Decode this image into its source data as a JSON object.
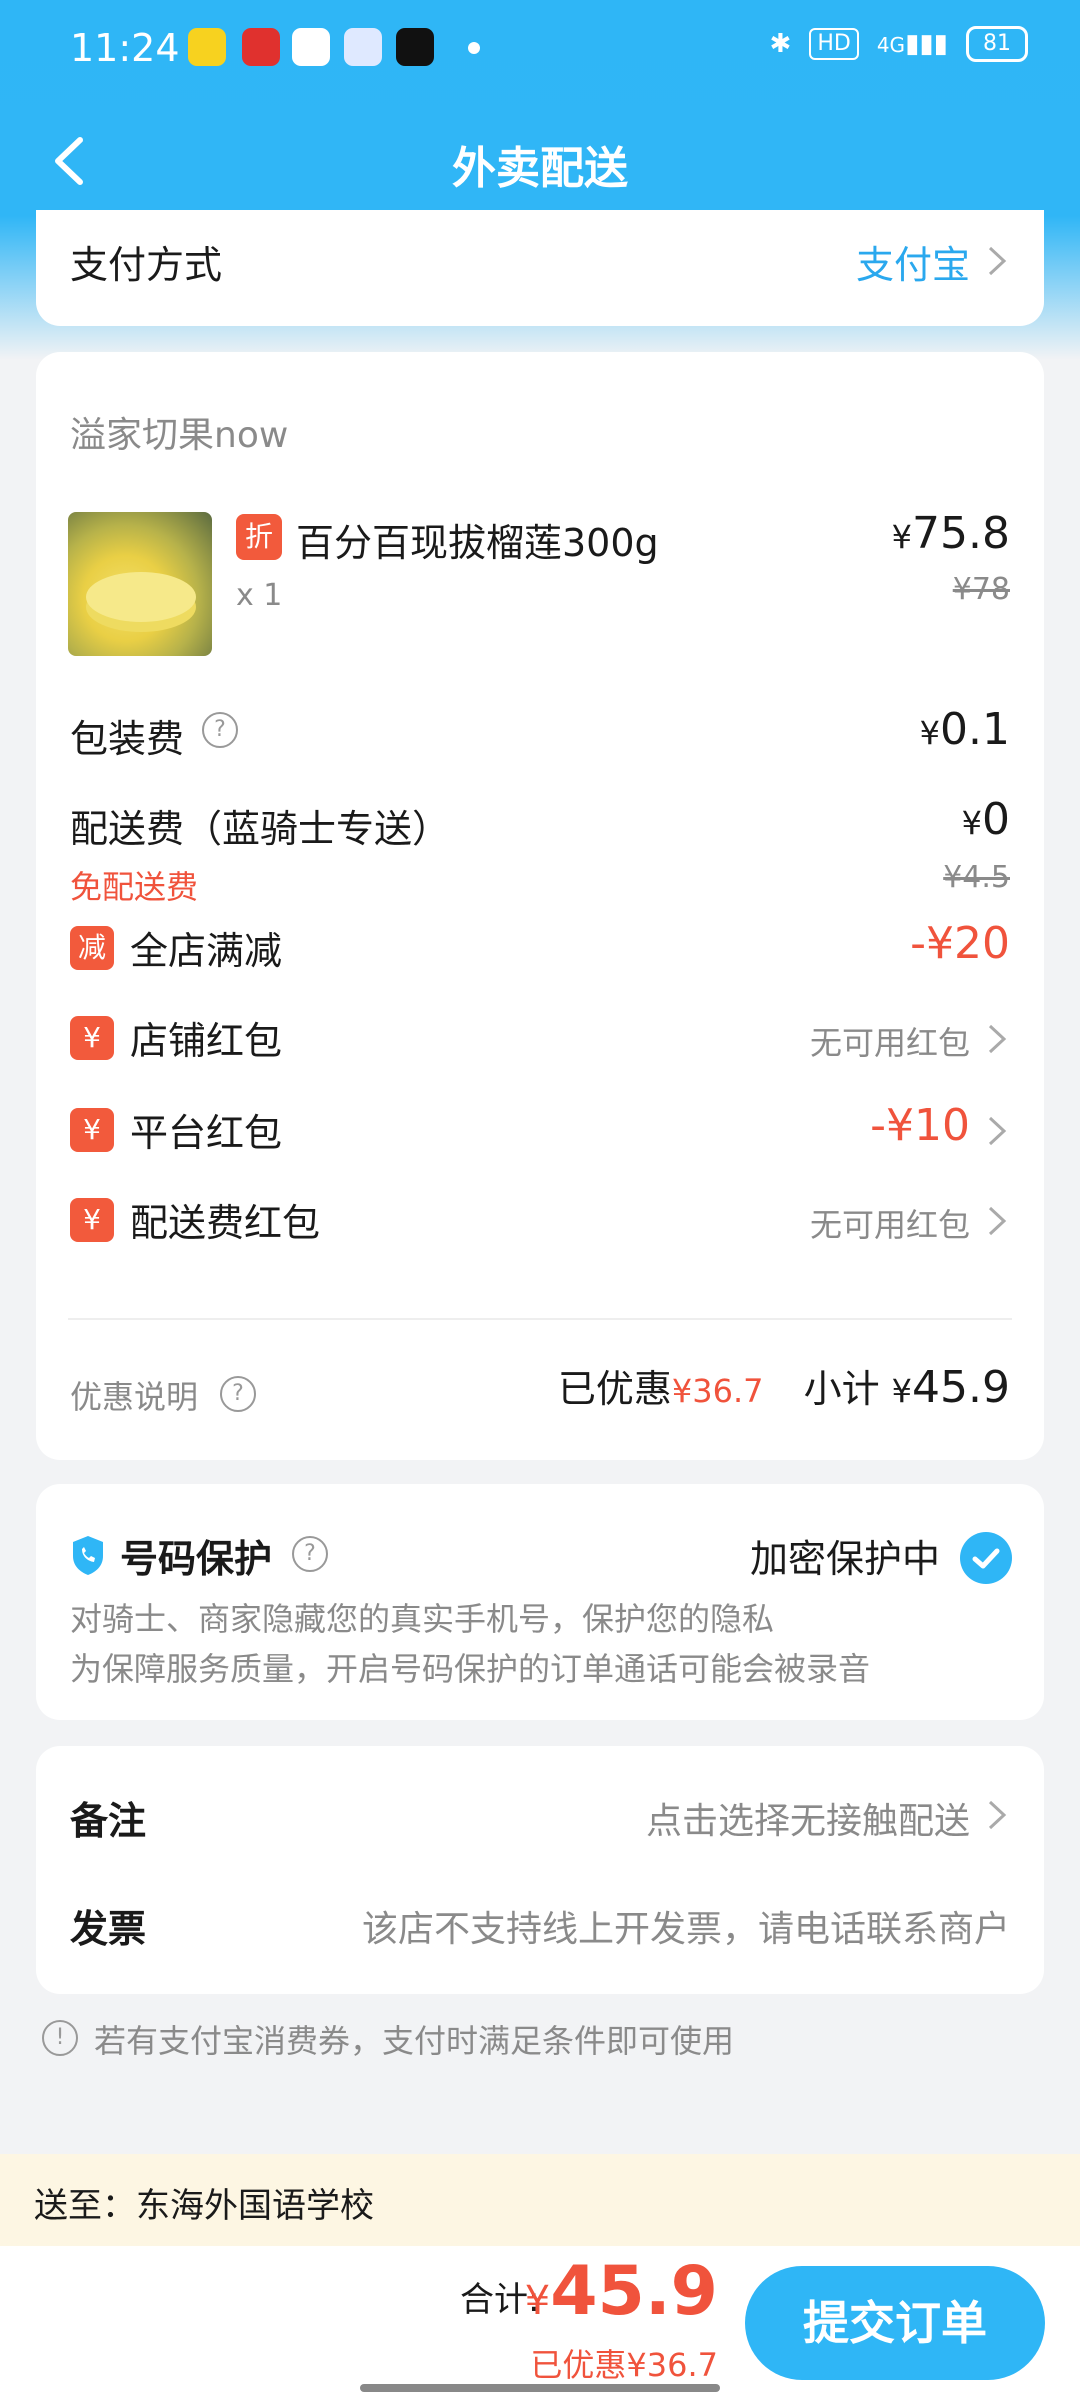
{
  "status_bar": {
    "time": "11:24",
    "hd": "HD",
    "network": "4G",
    "battery": "81"
  },
  "nav": {
    "title": "外卖配送"
  },
  "payment": {
    "label": "支付方式",
    "value": "支付宝"
  },
  "store": {
    "name": "溢家切果now",
    "product": {
      "discount_badge": "折",
      "name": "百分百现拔榴莲300g",
      "qty": "x 1",
      "price": "75.8",
      "original_price": "¥78"
    },
    "packaging": {
      "label": "包装费",
      "value": "0.1"
    },
    "delivery": {
      "label": "配送费（蓝骑士专送）",
      "free_note": "免配送费",
      "value": "0",
      "original": "¥4.5"
    },
    "store_discount": {
      "badge": "减",
      "label": "全店满减",
      "value": "-¥20"
    },
    "store_redpacket": {
      "badge": "¥",
      "label": "店铺红包",
      "value": "无可用红包"
    },
    "platform_redpacket": {
      "badge": "¥",
      "label": "平台红包",
      "value": "-¥10"
    },
    "delivery_redpacket": {
      "badge": "¥",
      "label": "配送费红包",
      "value": "无可用红包"
    },
    "summary": {
      "discount_info_label": "优惠说明",
      "saved_label": "已优惠",
      "saved_value": "¥36.7",
      "subtotal_label": "小计",
      "subtotal_value": "45.9"
    }
  },
  "privacy": {
    "title": "号码保护",
    "status": "加密保护中",
    "line1": "对骑士、商家隐藏您的真实手机号，保护您的隐私",
    "line2": "为保障服务质量，开启号码保护的订单通话可能会被录音"
  },
  "remarks": {
    "label": "备注",
    "value": "点击选择无接触配送"
  },
  "invoice": {
    "label": "发票",
    "value": "该店不支持线上开发票，请电话联系商户"
  },
  "tip": "若有支付宝消费券，支付时满足条件即可使用",
  "address": "送至：东海外国语学校",
  "checkout": {
    "total_label": "合计:",
    "total_value": "45.9",
    "saved_text": "已优惠¥36.7",
    "submit_label": "提交订单"
  },
  "colors": {
    "brand_blue": "#2fb6f6",
    "accent_red": "#f0533c"
  }
}
